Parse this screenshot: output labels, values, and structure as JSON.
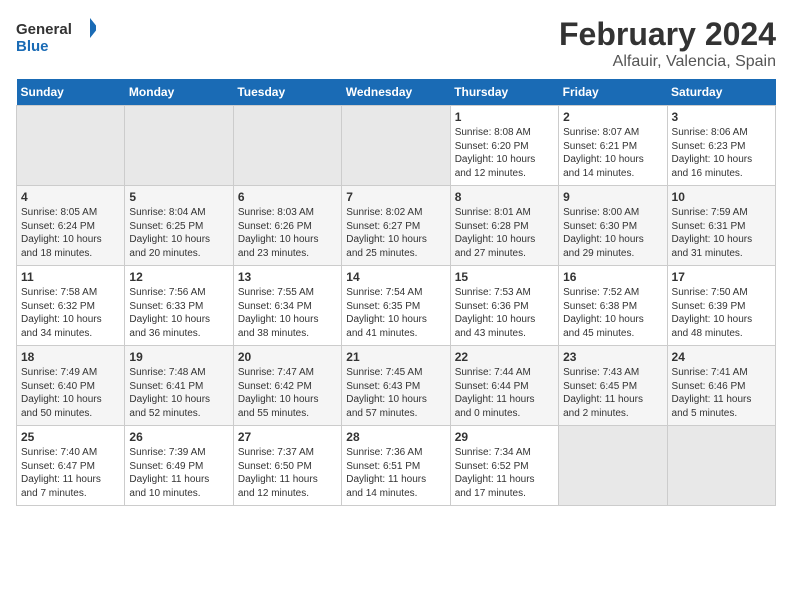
{
  "header": {
    "logo_general": "General",
    "logo_blue": "Blue",
    "month_year": "February 2024",
    "location": "Alfauir, Valencia, Spain"
  },
  "days_of_week": [
    "Sunday",
    "Monday",
    "Tuesday",
    "Wednesday",
    "Thursday",
    "Friday",
    "Saturday"
  ],
  "weeks": [
    {
      "days": [
        {
          "number": "",
          "info": "",
          "empty": true
        },
        {
          "number": "",
          "info": "",
          "empty": true
        },
        {
          "number": "",
          "info": "",
          "empty": true
        },
        {
          "number": "",
          "info": "",
          "empty": true
        },
        {
          "number": "1",
          "info": "Sunrise: 8:08 AM\nSunset: 6:20 PM\nDaylight: 10 hours\nand 12 minutes."
        },
        {
          "number": "2",
          "info": "Sunrise: 8:07 AM\nSunset: 6:21 PM\nDaylight: 10 hours\nand 14 minutes."
        },
        {
          "number": "3",
          "info": "Sunrise: 8:06 AM\nSunset: 6:23 PM\nDaylight: 10 hours\nand 16 minutes."
        }
      ]
    },
    {
      "days": [
        {
          "number": "4",
          "info": "Sunrise: 8:05 AM\nSunset: 6:24 PM\nDaylight: 10 hours\nand 18 minutes."
        },
        {
          "number": "5",
          "info": "Sunrise: 8:04 AM\nSunset: 6:25 PM\nDaylight: 10 hours\nand 20 minutes."
        },
        {
          "number": "6",
          "info": "Sunrise: 8:03 AM\nSunset: 6:26 PM\nDaylight: 10 hours\nand 23 minutes."
        },
        {
          "number": "7",
          "info": "Sunrise: 8:02 AM\nSunset: 6:27 PM\nDaylight: 10 hours\nand 25 minutes."
        },
        {
          "number": "8",
          "info": "Sunrise: 8:01 AM\nSunset: 6:28 PM\nDaylight: 10 hours\nand 27 minutes."
        },
        {
          "number": "9",
          "info": "Sunrise: 8:00 AM\nSunset: 6:30 PM\nDaylight: 10 hours\nand 29 minutes."
        },
        {
          "number": "10",
          "info": "Sunrise: 7:59 AM\nSunset: 6:31 PM\nDaylight: 10 hours\nand 31 minutes."
        }
      ]
    },
    {
      "days": [
        {
          "number": "11",
          "info": "Sunrise: 7:58 AM\nSunset: 6:32 PM\nDaylight: 10 hours\nand 34 minutes."
        },
        {
          "number": "12",
          "info": "Sunrise: 7:56 AM\nSunset: 6:33 PM\nDaylight: 10 hours\nand 36 minutes."
        },
        {
          "number": "13",
          "info": "Sunrise: 7:55 AM\nSunset: 6:34 PM\nDaylight: 10 hours\nand 38 minutes."
        },
        {
          "number": "14",
          "info": "Sunrise: 7:54 AM\nSunset: 6:35 PM\nDaylight: 10 hours\nand 41 minutes."
        },
        {
          "number": "15",
          "info": "Sunrise: 7:53 AM\nSunset: 6:36 PM\nDaylight: 10 hours\nand 43 minutes."
        },
        {
          "number": "16",
          "info": "Sunrise: 7:52 AM\nSunset: 6:38 PM\nDaylight: 10 hours\nand 45 minutes."
        },
        {
          "number": "17",
          "info": "Sunrise: 7:50 AM\nSunset: 6:39 PM\nDaylight: 10 hours\nand 48 minutes."
        }
      ]
    },
    {
      "days": [
        {
          "number": "18",
          "info": "Sunrise: 7:49 AM\nSunset: 6:40 PM\nDaylight: 10 hours\nand 50 minutes."
        },
        {
          "number": "19",
          "info": "Sunrise: 7:48 AM\nSunset: 6:41 PM\nDaylight: 10 hours\nand 52 minutes."
        },
        {
          "number": "20",
          "info": "Sunrise: 7:47 AM\nSunset: 6:42 PM\nDaylight: 10 hours\nand 55 minutes."
        },
        {
          "number": "21",
          "info": "Sunrise: 7:45 AM\nSunset: 6:43 PM\nDaylight: 10 hours\nand 57 minutes."
        },
        {
          "number": "22",
          "info": "Sunrise: 7:44 AM\nSunset: 6:44 PM\nDaylight: 11 hours\nand 0 minutes."
        },
        {
          "number": "23",
          "info": "Sunrise: 7:43 AM\nSunset: 6:45 PM\nDaylight: 11 hours\nand 2 minutes."
        },
        {
          "number": "24",
          "info": "Sunrise: 7:41 AM\nSunset: 6:46 PM\nDaylight: 11 hours\nand 5 minutes."
        }
      ]
    },
    {
      "days": [
        {
          "number": "25",
          "info": "Sunrise: 7:40 AM\nSunset: 6:47 PM\nDaylight: 11 hours\nand 7 minutes."
        },
        {
          "number": "26",
          "info": "Sunrise: 7:39 AM\nSunset: 6:49 PM\nDaylight: 11 hours\nand 10 minutes."
        },
        {
          "number": "27",
          "info": "Sunrise: 7:37 AM\nSunset: 6:50 PM\nDaylight: 11 hours\nand 12 minutes."
        },
        {
          "number": "28",
          "info": "Sunrise: 7:36 AM\nSunset: 6:51 PM\nDaylight: 11 hours\nand 14 minutes."
        },
        {
          "number": "29",
          "info": "Sunrise: 7:34 AM\nSunset: 6:52 PM\nDaylight: 11 hours\nand 17 minutes."
        },
        {
          "number": "",
          "info": "",
          "empty": true
        },
        {
          "number": "",
          "info": "",
          "empty": true
        }
      ]
    }
  ]
}
